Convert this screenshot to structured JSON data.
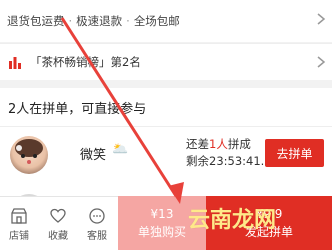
{
  "guarantees": {
    "items": [
      "退货包运费",
      "极速退款",
      "全场包邮"
    ],
    "separator": "·"
  },
  "ranking": {
    "text": "「茶杯畅销榜」第2名"
  },
  "groups": {
    "title": "2人在拼单，可直接参与",
    "rows": [
      {
        "name": "微笑",
        "emoji": "🌥️",
        "need_prefix": "还差",
        "need_count": "1人",
        "need_suffix": "拼成",
        "timer": "剩余23:53:41.3",
        "join_label": "去拼单"
      }
    ]
  },
  "bottom_nav": {
    "store": "店铺",
    "favorite": "收藏",
    "service": "客服"
  },
  "actions": {
    "solo_price": "¥13",
    "solo_label": "单独购买",
    "group_price": "¥9.9",
    "group_label": "发起拼单"
  },
  "watermark": "云南龙网",
  "colors": {
    "accent": "#e02e24",
    "solo_bg": "#f5a6a3"
  }
}
